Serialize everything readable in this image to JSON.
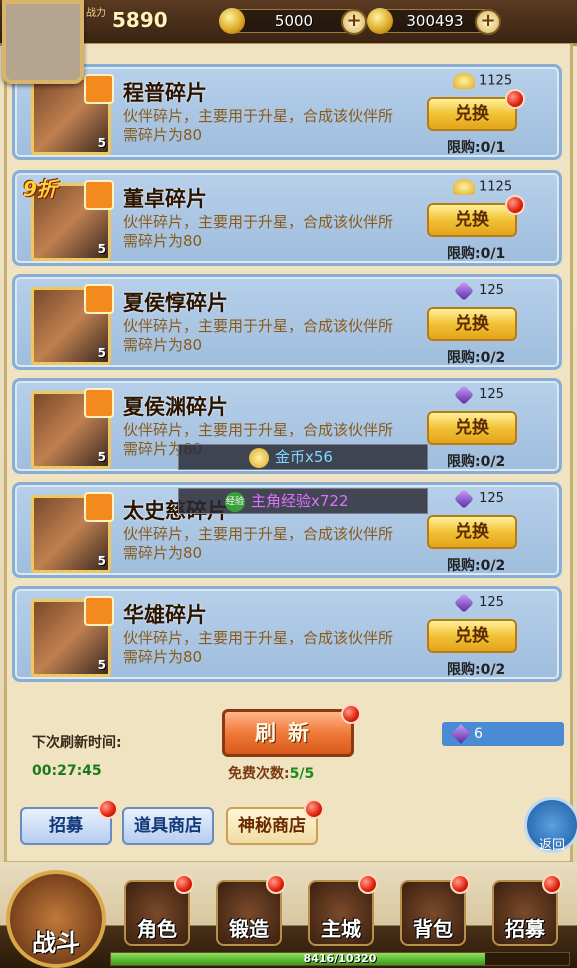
{
  "header": {
    "power_label": "战力",
    "power_value": "5890",
    "currency_1": "5000",
    "currency_2": "300493",
    "plus": "+"
  },
  "items": [
    {
      "name": "程普碎片",
      "desc": "伙伴碎片，主要用于升星，合成该伙伴所需碎片为80",
      "price": "1125",
      "price_type": "gold",
      "button": "兑换",
      "limit": "限购:0/1",
      "count": "5",
      "discount": ""
    },
    {
      "name": "董卓碎片",
      "desc": "伙伴碎片，主要用于升星，合成该伙伴所需碎片为80",
      "price": "1125",
      "price_type": "gold",
      "button": "兑换",
      "limit": "限购:0/1",
      "count": "5",
      "discount": "9折"
    },
    {
      "name": "夏侯惇碎片",
      "desc": "伙伴碎片，主要用于升星，合成该伙伴所需碎片为80",
      "price": "125",
      "price_type": "gem",
      "button": "兑换",
      "limit": "限购:0/2",
      "count": "5",
      "discount": ""
    },
    {
      "name": "夏侯渊碎片",
      "desc": "伙伴碎片，主要用于升星，合成该伙伴所需碎片为80",
      "price": "125",
      "price_type": "gem",
      "button": "兑换",
      "limit": "限购:0/2",
      "count": "5",
      "discount": ""
    },
    {
      "name": "太史慈碎片",
      "desc": "伙伴碎片，主要用于升星，合成该伙伴所需碎片为80",
      "price": "125",
      "price_type": "gem",
      "button": "兑换",
      "limit": "限购:0/2",
      "count": "5",
      "discount": ""
    },
    {
      "name": "华雄碎片",
      "desc": "伙伴碎片，主要用于升星，合成该伙伴所需碎片为80",
      "price": "125",
      "price_type": "gem",
      "button": "兑换",
      "limit": "限购:0/2",
      "count": "5",
      "discount": ""
    }
  ],
  "toasts": {
    "gold": "金币x56",
    "exp_badge": "经验",
    "exp": "主角经验x722"
  },
  "footer": {
    "refresh_label": "下次刷新时间:",
    "timer": "00:27:45",
    "refresh_button": "刷新",
    "free_label": "免费次数:",
    "free_count": "5/5",
    "gem_count": "6"
  },
  "tabs": [
    {
      "label": "招募",
      "active": false
    },
    {
      "label": "道具商店",
      "active": false
    },
    {
      "label": "神秘商店",
      "active": true
    }
  ],
  "back_label": "返回",
  "nav": {
    "battle": "战斗",
    "role": "角色",
    "forge": "锻造",
    "city": "主城",
    "bag": "背包",
    "recruit": "招募"
  },
  "xp": {
    "text": "8416/10320",
    "current": 8416,
    "max": 10320
  },
  "colors": {
    "accent": "#f2c236",
    "panel_blue": "#9fbddd",
    "notify_red": "#e0200a"
  }
}
